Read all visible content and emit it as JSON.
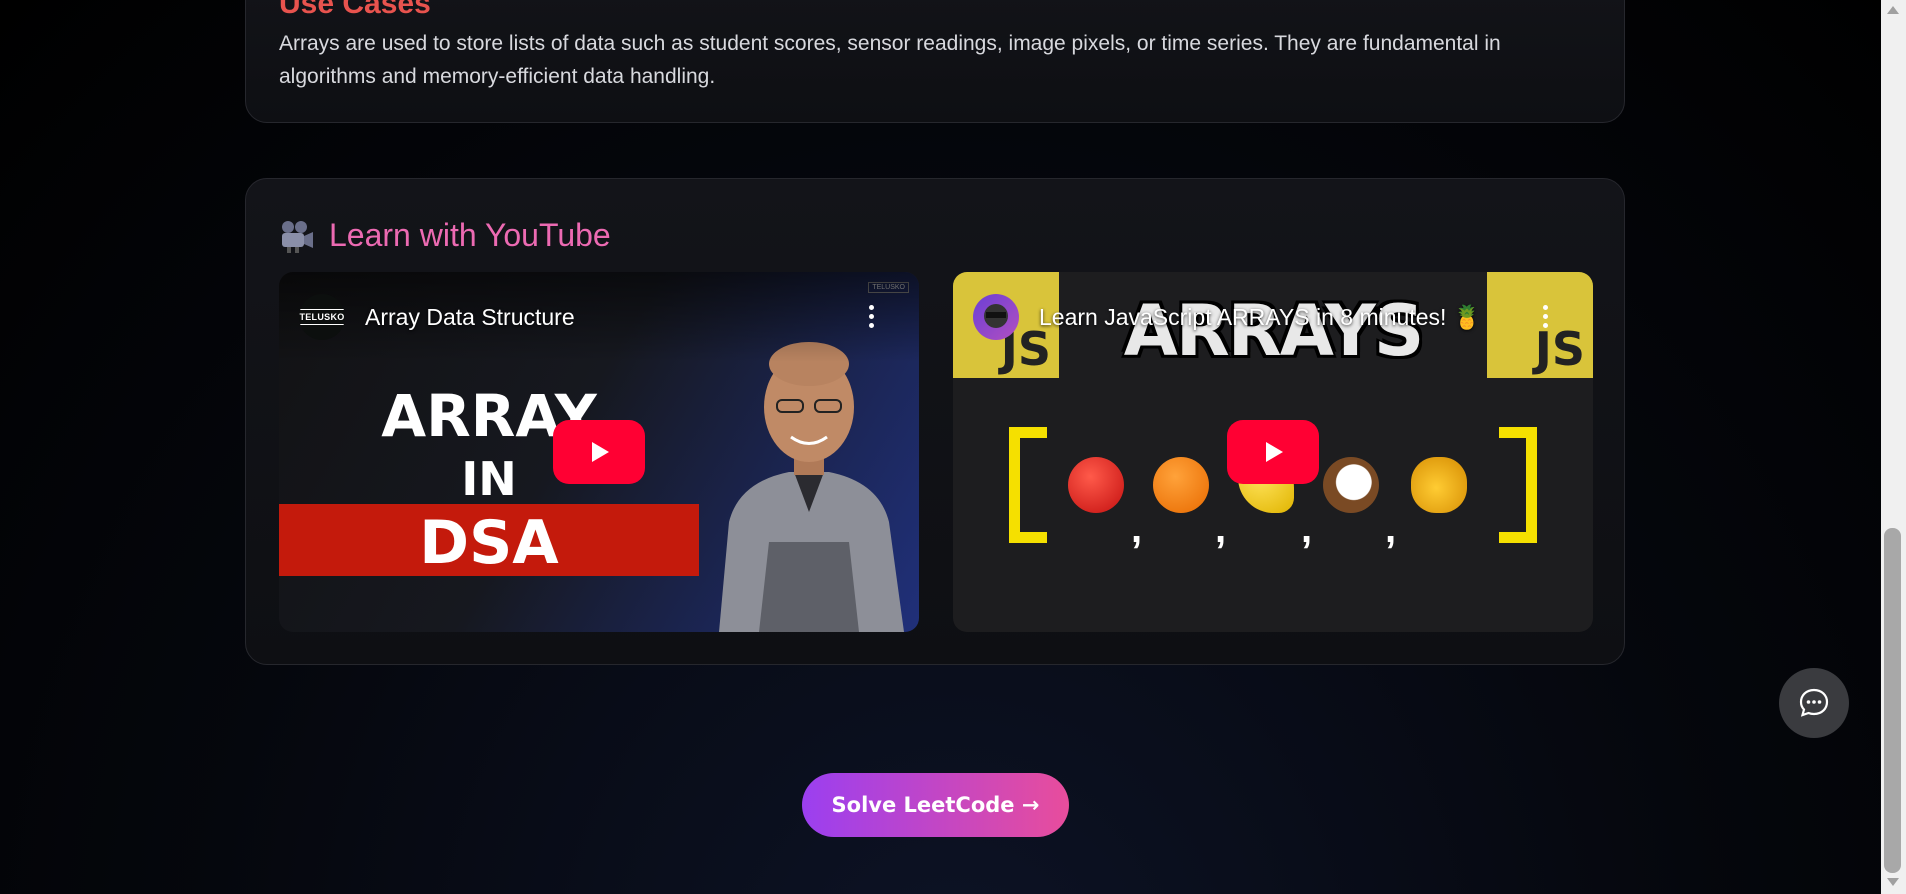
{
  "use_cases": {
    "heading": "Use Cases",
    "text": "Arrays are used to store lists of data such as student scores, sensor readings, image pixels, or time series. They are fundamental in algorithms and memory-efficient data handling."
  },
  "youtube": {
    "heading": "Learn with YouTube",
    "heading_icon": "movie-camera-icon",
    "videos": [
      {
        "title": "Array Data Structure",
        "channel_badge": "TELUSKO",
        "thumb_text": [
          "ARRAY",
          "IN",
          "DSA"
        ]
      },
      {
        "title": "Learn JavaScript ARRAYS in 8 minutes! 🍍",
        "thumb_word": "ARRAYS",
        "js_label": "JS"
      }
    ]
  },
  "cta": {
    "label": "Solve LeetCode →"
  },
  "colors": {
    "accent_pink": "#ec6ab2",
    "button_gradient_start": "#9b3ff0",
    "button_gradient_end": "#e84d9c",
    "youtube_red": "#ff0033"
  }
}
